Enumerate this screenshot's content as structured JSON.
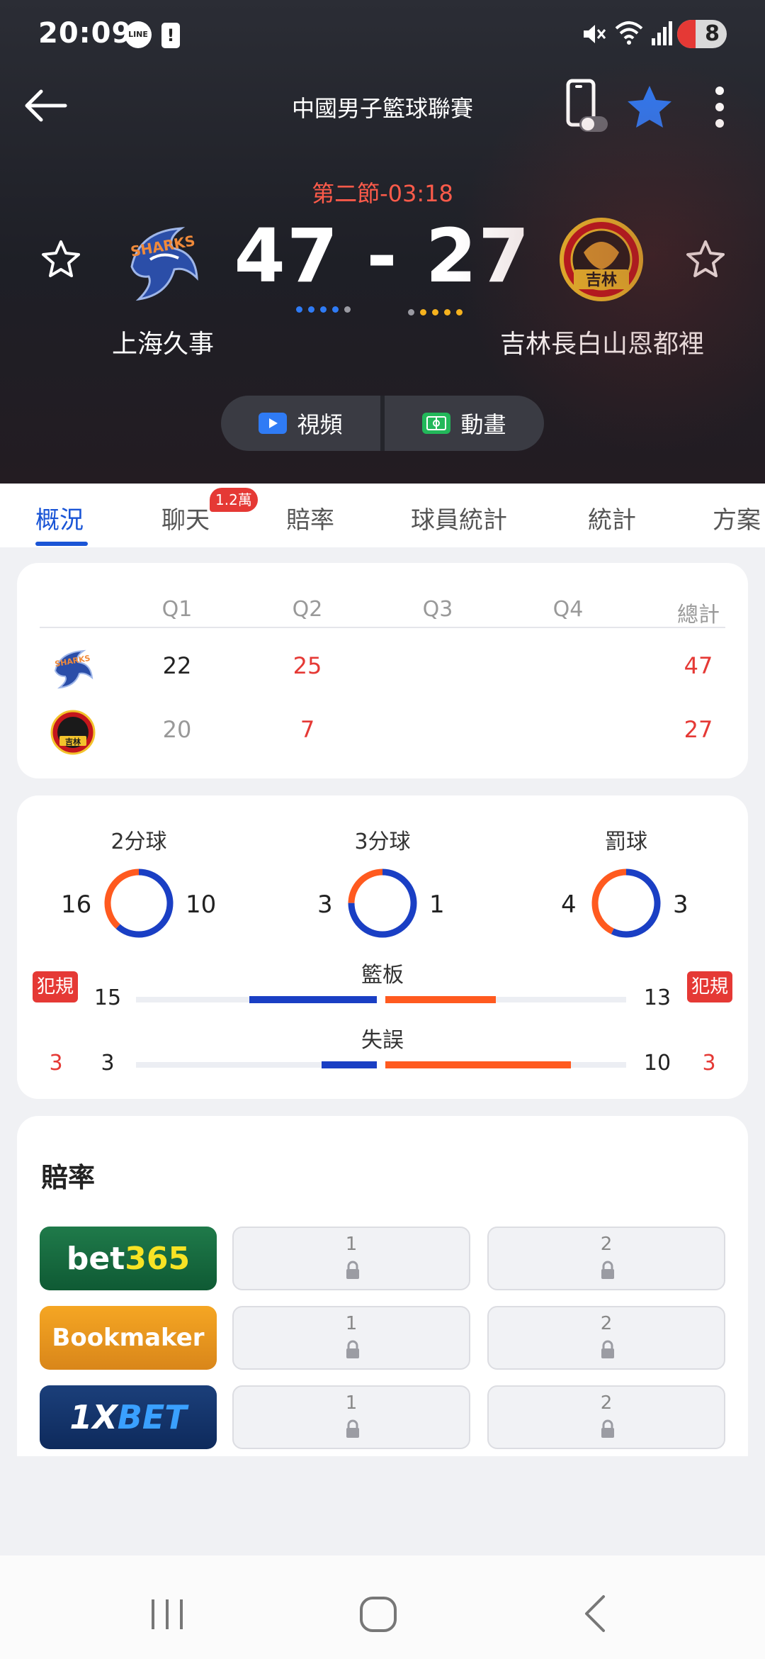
{
  "status_bar": {
    "time": "20:09",
    "line_badge": "LINE",
    "alert_glyph": "!",
    "battery": "8"
  },
  "header": {
    "league": "中國男子籃球聯賽",
    "period": "第二節-03:18",
    "score": "47 - 27",
    "home": {
      "name": "上海久事",
      "logo_text": "SHARKS"
    },
    "away": {
      "name": "吉林長白山恩都裡",
      "logo_text": "吉林"
    },
    "video_label": "視頻",
    "animation_label": "動畫"
  },
  "tabs": {
    "items": [
      "概況",
      "聊天",
      "賠率",
      "球員統計",
      "統計",
      "方案"
    ],
    "chat_badge": "1.2萬"
  },
  "scoreboard": {
    "headers": [
      "Q1",
      "Q2",
      "Q3",
      "Q4",
      "總計"
    ],
    "home": [
      "22",
      "25",
      "",
      "",
      "47"
    ],
    "away": [
      "20",
      "7",
      "",
      "",
      "27"
    ]
  },
  "stats": {
    "two_pt": {
      "label": "2分球",
      "home": "16",
      "away": "10",
      "home_share": 0.615
    },
    "three_pt": {
      "label": "3分球",
      "home": "3",
      "away": "1",
      "home_share": 0.75
    },
    "free_throw": {
      "label": "罰球",
      "home": "4",
      "away": "3",
      "home_share": 0.571
    },
    "rebounds": {
      "label": "籃板",
      "home": "15",
      "away": "13",
      "home_share_of_max": 0.53,
      "away_share_of_max": 0.46
    },
    "turnovers": {
      "label": "失誤",
      "home": "3",
      "away": "10",
      "home_share_of_max": 0.23,
      "away_share_of_max": 0.77
    },
    "fouls": {
      "label": "犯規",
      "home": "3",
      "away": "3"
    },
    "colors": {
      "home": "#1a3fc4",
      "away": "#ff5a1f"
    }
  },
  "odds": {
    "title": "賠率",
    "rows": [
      {
        "bookmaker": "bet365",
        "opt1": "1",
        "opt2": "2"
      },
      {
        "bookmaker": "Bookmaker",
        "opt1": "1",
        "opt2": "2"
      },
      {
        "bookmaker": "1XBET",
        "opt1": "1",
        "opt2": "2"
      }
    ]
  }
}
